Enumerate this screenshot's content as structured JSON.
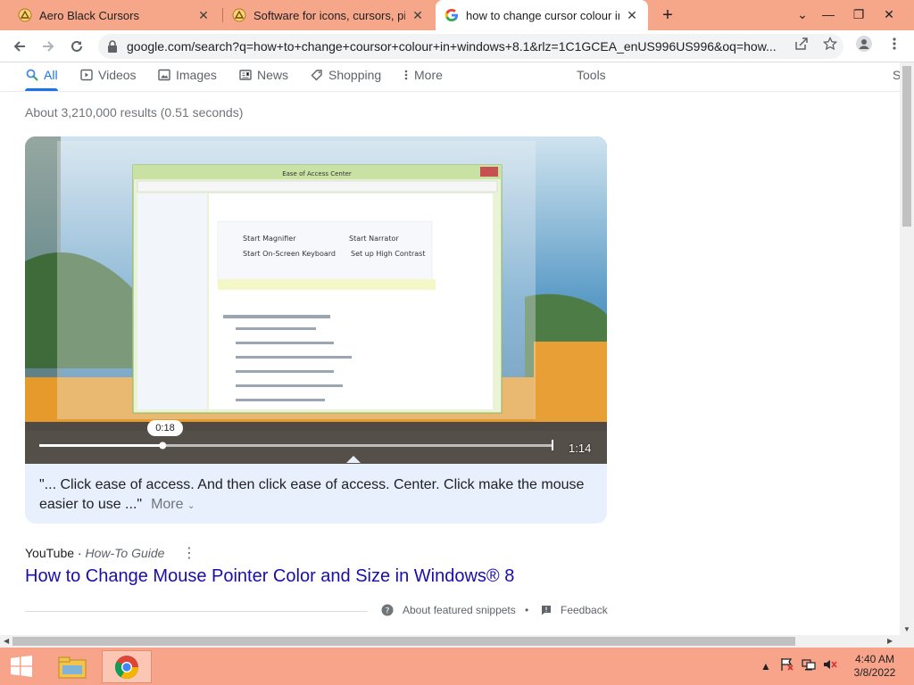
{
  "browser": {
    "tabs": [
      {
        "title": "Aero Black Cursors",
        "active": false
      },
      {
        "title": "Software for icons, cursors, pictu",
        "active": false
      },
      {
        "title": "how to change cursor colour in w",
        "active": true
      }
    ],
    "url": "google.com/search?q=how+to+change+coursor+colour+in+windows+8.1&rlz=1C1GCEA_enUS996US996&oq=how..."
  },
  "search_tabs": [
    {
      "label": "All",
      "icon": "search-icon"
    },
    {
      "label": "Videos",
      "icon": "video-icon"
    },
    {
      "label": "Images",
      "icon": "image-icon"
    },
    {
      "label": "News",
      "icon": "news-icon"
    },
    {
      "label": "Shopping",
      "icon": "tag-icon"
    },
    {
      "label": "More",
      "icon": "dots-vertical-icon"
    },
    {
      "label": "Tools",
      "icon": ""
    },
    {
      "label": "S",
      "icon": ""
    }
  ],
  "results_stats": "About 3,210,000 results (0.51 seconds)",
  "featured_snippet": {
    "video_time": "0:18",
    "video_duration": "1:14",
    "video_progress": 0.24,
    "caption": "\"... Click ease of access. And then click ease of access. Center. Click make the mouse easier to use ...\"",
    "more_label": "More",
    "source": "YouTube",
    "source_sub": "How-To Guide",
    "title": "How to Change Mouse Pointer Color and Size in Windows® 8",
    "about_label": "About featured snippets",
    "feedback_label": "Feedback",
    "inner_window_title": "Ease of Access Center",
    "inner_items": [
      "Start Magnifier",
      "Start Narrator",
      "Start On-Screen Keyboard",
      "Set up High Contrast"
    ]
  },
  "taskbar": {
    "time": "4:40 AM",
    "date": "3/8/2022"
  },
  "colors": {
    "tabstrip": "#f6a78a",
    "taskbar": "#f7a48a",
    "link": "#1a0dab",
    "accent": "#1a73e8"
  }
}
